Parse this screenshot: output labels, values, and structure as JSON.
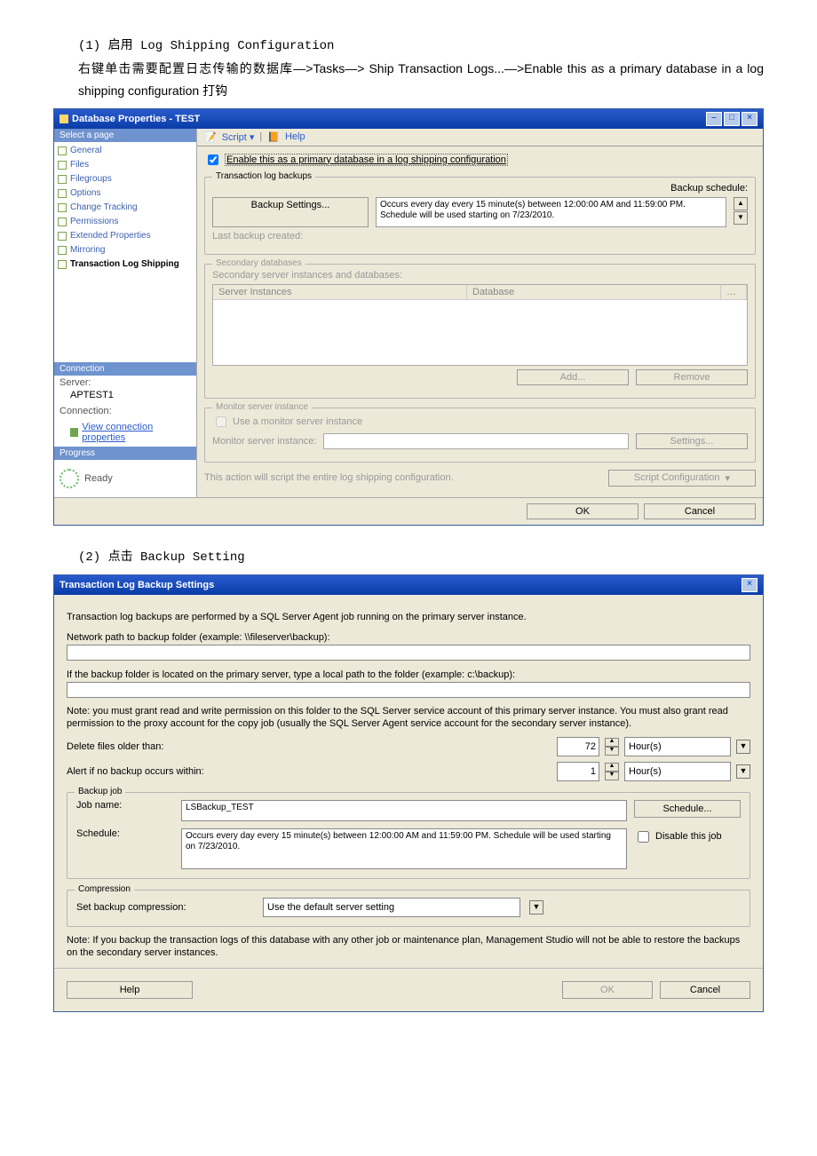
{
  "doc": {
    "line1": "(1) 启用 Log Shipping Configuration",
    "line2": "右键单击需要配置日志传输的数据库—>Tasks—> Ship Transaction Logs...—>Enable this as a primary database in a log shipping configuration 打钩",
    "line3": "(2) 点击 Backup Setting"
  },
  "dlg1": {
    "title": "Database Properties - TEST",
    "winMin": "–",
    "winMax": "□",
    "winClose": "×",
    "selectPage": "Select a page",
    "pages": {
      "general": "General",
      "files": "Files",
      "filegroups": "Filegroups",
      "options": "Options",
      "changeTracking": "Change Tracking",
      "permissions": "Permissions",
      "extended": "Extended Properties",
      "mirroring": "Mirroring",
      "tls": "Transaction Log Shipping"
    },
    "connectionHeader": "Connection",
    "serverLabel": "Server:",
    "serverValue": "APTEST1",
    "connectionLabel": "Connection:",
    "viewConn": "View connection properties",
    "progressHeader": "Progress",
    "ready": "Ready",
    "toolbar": {
      "script": "Script",
      "help": "Help"
    },
    "enableChk": "Enable this as a primary database in a log shipping configuration",
    "txLogBackups": "Transaction log backups",
    "backupSchedule": "Backup schedule:",
    "backupSettings": "Backup Settings...",
    "scheduleText": "Occurs every day every 15 minute(s) between 12:00:00 AM and 11:59:00 PM. Schedule will be used starting on 7/23/2010.",
    "lastBackup": "Last backup created:",
    "secondaryDatabases": "Secondary databases",
    "secondaryInstances": "Secondary server instances and databases:",
    "colServer": "Server Instances",
    "colDb": "Database",
    "addBtn": "Add...",
    "removeBtn": "Remove",
    "monitorInstance": "Monitor server instance",
    "useMonitor": "Use a monitor server instance",
    "monitorLabel": "Monitor server instance:",
    "settingsBtn": "Settings...",
    "scriptNote": "This action will script the entire log shipping configuration.",
    "scriptConfig": "Script Configuration",
    "ok": "OK",
    "cancel": "Cancel"
  },
  "dlg2": {
    "title": "Transaction Log Backup Settings",
    "close": "×",
    "intro": "Transaction log backups are performed by a SQL Server Agent job running on the primary server instance.",
    "netPathLabel": "Network path to backup folder (example: \\\\fileserver\\backup):",
    "localPathLabel": "If the backup folder is located on the primary server, type a local path to the folder (example: c:\\backup):",
    "permNote": "Note: you must grant read and write permission on this folder to the SQL Server service account of this primary server instance. You must also grant read permission to the proxy account for the copy job (usually the SQL Server Agent service account for the secondary server instance).",
    "deleteOlder": "Delete files older than:",
    "deleteVal": "72",
    "deleteUnit": "Hour(s)",
    "alertIf": "Alert if no backup occurs within:",
    "alertVal": "1",
    "alertUnit": "Hour(s)",
    "backupJob": "Backup job",
    "jobNameLabel": "Job name:",
    "jobNameVal": "LSBackup_TEST",
    "scheduleBtn": "Schedule...",
    "scheduleLabel": "Schedule:",
    "scheduleVal": "Occurs every day every 15 minute(s) between 12:00:00 AM and 11:59:00 PM. Schedule will be used starting on 7/23/2010.",
    "disableJob": "Disable this job",
    "compression": "Compression",
    "compLabel": "Set backup compression:",
    "compVal": "Use the default server setting",
    "bottomNote": "Note: If you backup the transaction logs of this database with any other job or maintenance plan, Management Studio will not be able to restore the backups on the secondary server instances.",
    "help": "Help",
    "ok": "OK",
    "cancel": "Cancel"
  }
}
